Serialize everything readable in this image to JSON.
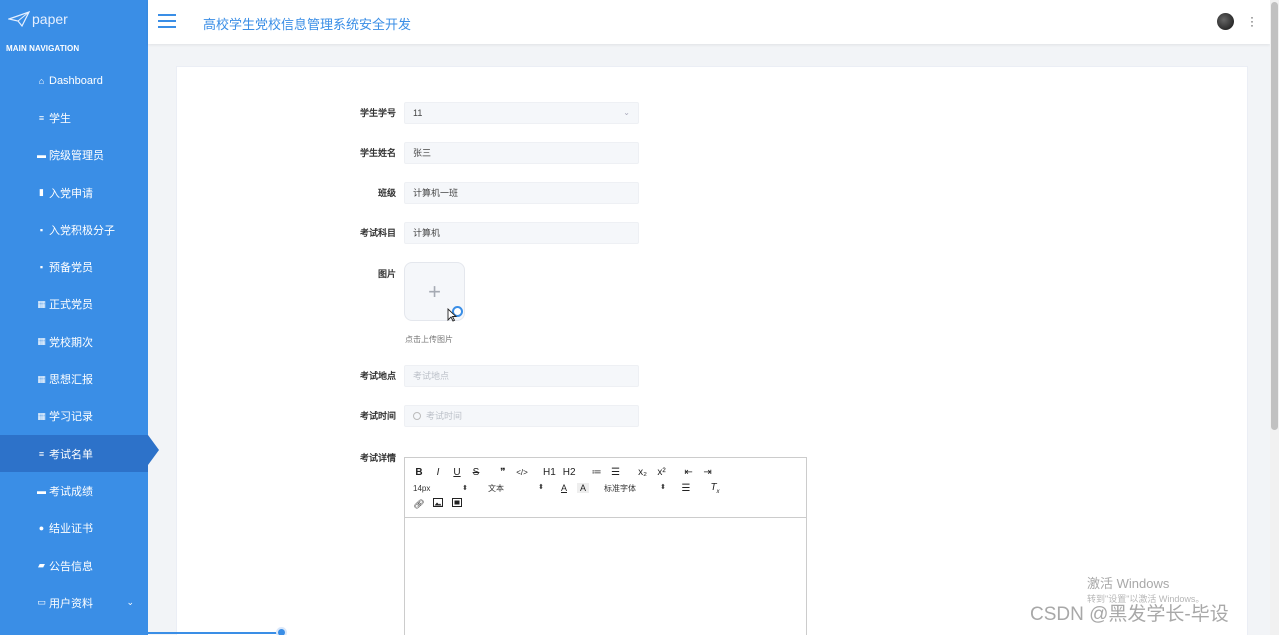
{
  "sidebar": {
    "brand": "paper",
    "nav_title": "MAIN NAVIGATION",
    "items": [
      {
        "label": "Dashboard",
        "icon": "home-icon"
      },
      {
        "label": "学生",
        "icon": "list-icon"
      },
      {
        "label": "院级管理员",
        "icon": "card-icon"
      },
      {
        "label": "入党申请",
        "icon": "chart-icon"
      },
      {
        "label": "入党积极分子",
        "icon": "clipboard-icon"
      },
      {
        "label": "预备党员",
        "icon": "clipboard-icon"
      },
      {
        "label": "正式党员",
        "icon": "grid-icon"
      },
      {
        "label": "党校期次",
        "icon": "grid-icon"
      },
      {
        "label": "思想汇报",
        "icon": "grid-icon"
      },
      {
        "label": "学习记录",
        "icon": "grid-icon"
      },
      {
        "label": "考试名单",
        "icon": "list-icon",
        "active": true
      },
      {
        "label": "考试成绩",
        "icon": "monitor-icon"
      },
      {
        "label": "结业证书",
        "icon": "user-icon"
      },
      {
        "label": "公告信息",
        "icon": "chat-icon"
      },
      {
        "label": "用户资料",
        "icon": "window-icon",
        "expandable": true
      }
    ]
  },
  "header": {
    "title": "高校学生党校信息管理系统安全开发"
  },
  "form": {
    "student_id": {
      "label": "学生学号",
      "value": "11"
    },
    "student_name": {
      "label": "学生姓名",
      "value": "张三"
    },
    "class": {
      "label": "班级",
      "value": "计算机一班"
    },
    "subject": {
      "label": "考试科目",
      "value": "计算机"
    },
    "image": {
      "label": "图片",
      "hint": "点击上传图片"
    },
    "location": {
      "label": "考试地点",
      "placeholder": "考试地点"
    },
    "time": {
      "label": "考试时间",
      "placeholder": "考试时间"
    },
    "details": {
      "label": "考试详情"
    }
  },
  "editor": {
    "toolbar_row1": [
      "B",
      "I",
      "U",
      "S",
      "❞",
      "</>",
      "H1",
      "H2",
      "≔",
      "☰",
      "x₂",
      "x²",
      "⇤",
      "⇥"
    ],
    "font_size": "14px",
    "header_type": "文本",
    "font_family": "标准字体",
    "colors": {
      "border": "#cccccc"
    }
  },
  "watermark": {
    "activate_title": "激活 Windows",
    "activate_sub": "转到\"设置\"以激活 Windows。",
    "csdn": "CSDN @黑发学长-毕设"
  },
  "colors": {
    "primary": "#3a8ee6",
    "sidebar_active": "#2d72c9"
  }
}
